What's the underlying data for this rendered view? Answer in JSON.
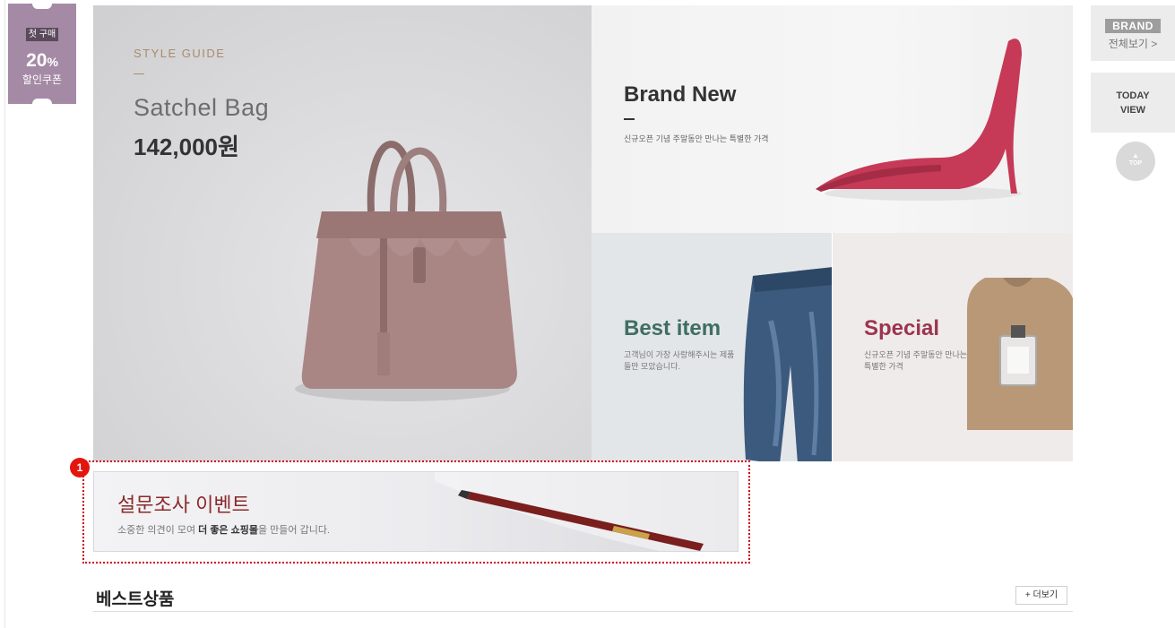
{
  "coupon": {
    "tag": "첫 구매",
    "percent_value": "20",
    "percent_sign": "%",
    "label": "할인쿠폰",
    "color": "#a58aa6"
  },
  "hero": {
    "kicker": "STYLE GUIDE",
    "title": "Satchel Bag",
    "price": "142,000원"
  },
  "brand_new": {
    "title": "Brand New",
    "desc": "신규오픈 기념 주말동안 만나는 특별한 가격"
  },
  "best_item": {
    "title": "Best item",
    "desc": "고객님이 가장 사랑해주시는 제품들만 모았습니다.",
    "color": "#3f6e62"
  },
  "special": {
    "title": "Special",
    "desc": "신규오픈 기념 주말동안 만나는 특별한 가격",
    "color": "#9c3450"
  },
  "survey": {
    "marker": "1",
    "title": "설문조사 이벤트",
    "desc_pre": "소중한 의견이 모여 ",
    "desc_bold": "더 좋은 쇼핑몰",
    "desc_post": "을 만들어 갑니다."
  },
  "best_products": {
    "title": "베스트상품",
    "more": "+ 더보기"
  },
  "rail": {
    "brand_badge": "BRAND",
    "brand_link": "전체보기 >",
    "today_line1": "TODAY",
    "today_line2": "VIEW",
    "top_icon": "chevron-up-icon",
    "top_label": "TOP"
  }
}
